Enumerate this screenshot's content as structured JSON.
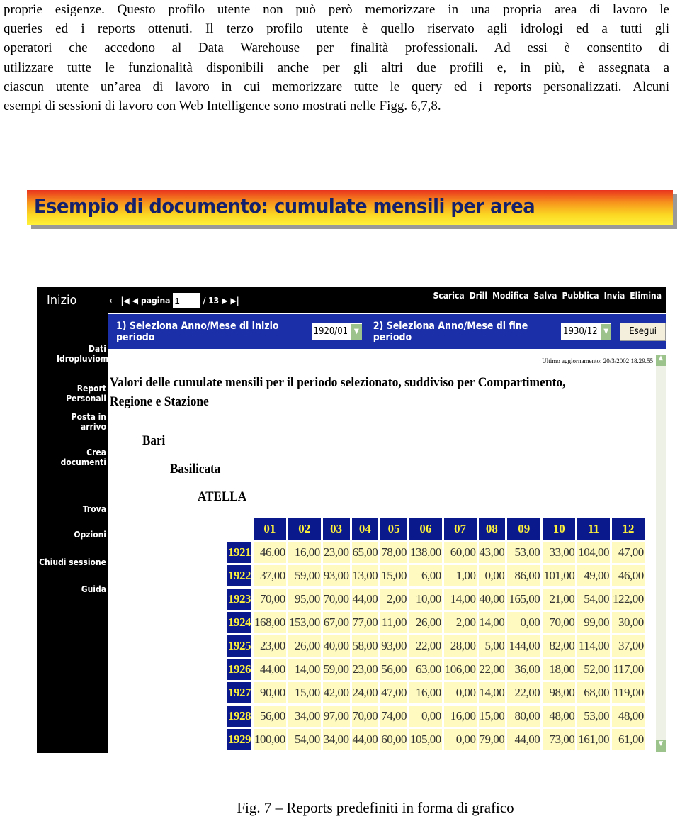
{
  "paragraph": {
    "lines": [
      "proprie esigenze. Questo profilo utente non può però memorizzare in una propria area di lavoro le",
      "queries ed i reports ottenuti. Il terzo profilo utente è quello riservato agli idrologi ed a tutti gli",
      "operatori che accedono al Data Warehouse per finalità professionali. Ad essi è consentito di",
      "utilizzare tutte le funzionalità disponibili anche per gli altri due profili e, in più, è assegnata a",
      "ciascun utente un’area di lavoro in cui memorizzare tutte le query ed i reports personalizzati. Alcuni",
      "esempi di sessioni di lavoro con Web Intelligence sono mostrati nelle Figg. 6,7,8."
    ]
  },
  "banner": {
    "title": "Esempio di documento: cumulate mensili per area"
  },
  "app": {
    "home": "Inizio",
    "nav": {
      "prev": "‹",
      "first": "|◀",
      "back": "◀",
      "page_label": "pagina",
      "page_value": "1",
      "total": "/ 13",
      "next": "▶",
      "last": "▶|"
    },
    "menu": [
      "Scarica",
      "Drill",
      "Modifica",
      "Salva",
      "Pubblica",
      "Invia",
      "Elimina"
    ],
    "sidebar": [
      "Dati Idropluviometrici",
      "Report Personali",
      "Posta in arrivo",
      "Crea documenti",
      "Trova",
      "Opzioni",
      "Chiudi sessione",
      "Guida"
    ],
    "filter": {
      "start_label": "1) Seleziona Anno/Mese di inizio periodo",
      "start_value": "1920/01",
      "end_label": "2) Seleziona Anno/Mese di fine periodo",
      "end_value": "1930/12",
      "run": "Esegui"
    },
    "updated": "Ultimo aggiornamento: 20/3/2002 18.29.55",
    "report_title": "Valori delle cumulate mensili per il periodo selezionato, suddiviso per Compartimento, Regione e Stazione",
    "compartimento": "Bari",
    "regione": "Basilicata",
    "stazione": "ATELLA",
    "table": {
      "columns": [
        "01",
        "02",
        "03",
        "04",
        "05",
        "06",
        "07",
        "08",
        "09",
        "10",
        "11",
        "12"
      ],
      "rows": [
        {
          "year": "1921",
          "values": [
            "46,00",
            "16,00",
            "23,00",
            "65,00",
            "78,00",
            "138,00",
            "60,00",
            "43,00",
            "53,00",
            "33,00",
            "104,00",
            "47,00"
          ]
        },
        {
          "year": "1922",
          "values": [
            "37,00",
            "59,00",
            "93,00",
            "13,00",
            "15,00",
            "6,00",
            "1,00",
            "0,00",
            "86,00",
            "101,00",
            "49,00",
            "46,00"
          ]
        },
        {
          "year": "1923",
          "values": [
            "70,00",
            "95,00",
            "70,00",
            "44,00",
            "2,00",
            "10,00",
            "14,00",
            "40,00",
            "165,00",
            "21,00",
            "54,00",
            "122,00"
          ]
        },
        {
          "year": "1924",
          "values": [
            "168,00",
            "153,00",
            "67,00",
            "77,00",
            "11,00",
            "26,00",
            "2,00",
            "14,00",
            "0,00",
            "70,00",
            "99,00",
            "30,00"
          ]
        },
        {
          "year": "1925",
          "values": [
            "23,00",
            "26,00",
            "40,00",
            "58,00",
            "93,00",
            "22,00",
            "28,00",
            "5,00",
            "144,00",
            "82,00",
            "114,00",
            "37,00"
          ]
        },
        {
          "year": "1926",
          "values": [
            "44,00",
            "14,00",
            "59,00",
            "23,00",
            "56,00",
            "63,00",
            "106,00",
            "22,00",
            "36,00",
            "18,00",
            "52,00",
            "117,00"
          ]
        },
        {
          "year": "1927",
          "values": [
            "90,00",
            "15,00",
            "42,00",
            "24,00",
            "47,00",
            "16,00",
            "0,00",
            "14,00",
            "22,00",
            "98,00",
            "68,00",
            "119,00"
          ]
        },
        {
          "year": "1928",
          "values": [
            "56,00",
            "34,00",
            "97,00",
            "70,00",
            "74,00",
            "0,00",
            "16,00",
            "15,00",
            "80,00",
            "48,00",
            "53,00",
            "48,00"
          ]
        },
        {
          "year": "1929",
          "values": [
            "100,00",
            "54,00",
            "34,00",
            "44,00",
            "60,00",
            "105,00",
            "0,00",
            "79,00",
            "44,00",
            "73,00",
            "161,00",
            "61,00"
          ]
        }
      ]
    }
  },
  "caption": "Fig. 7 – Reports predefiniti in forma di grafico",
  "colors": {
    "header_blue": "#0a1a8c",
    "header_text": "#fff23a",
    "cell_bg": "#fffbc0",
    "bar_blue": "#1b2fa8"
  }
}
